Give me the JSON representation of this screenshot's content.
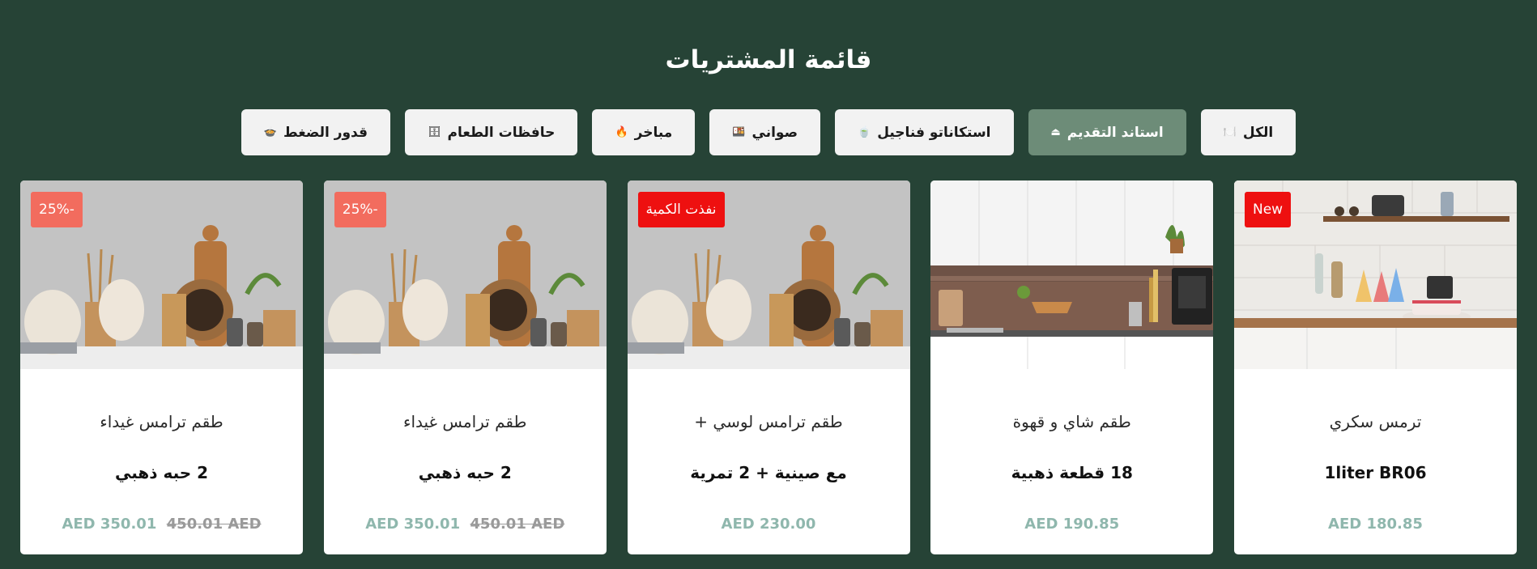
{
  "header": {
    "title": "قائمة المشتريات"
  },
  "filters": [
    {
      "label": "الكل",
      "icon": "🍽️",
      "active": false
    },
    {
      "label": "استاند التقديم",
      "icon": "⏏",
      "active": true
    },
    {
      "label": "استكاناتو فناجيل",
      "icon": "🍵",
      "active": false
    },
    {
      "label": "صواني",
      "icon": "🍱",
      "active": false
    },
    {
      "label": "مباخر",
      "icon": "🔥",
      "active": false
    },
    {
      "label": "حافظات الطعام",
      "icon": "🗄",
      "active": false
    },
    {
      "label": "قدور الضغط",
      "icon": "🍲",
      "active": false
    }
  ],
  "products": [
    {
      "name": "ترمس سكري",
      "subtitle": "1liter BR06",
      "price": "AED 180.85",
      "old_price": "",
      "badge": "New",
      "badge_type": "new",
      "image": "kitchen-shelf"
    },
    {
      "name": "طقم شاي و قهوة",
      "subtitle": "18 قطعة ذهبية",
      "price": "AED 190.85",
      "old_price": "",
      "badge": "",
      "badge_type": "",
      "image": "kitchen-counter"
    },
    {
      "name": "طقم ترامس لوسي +",
      "subtitle": "مع صينية + 2 تمرية",
      "price": "AED 230.00",
      "old_price": "",
      "badge": "نفذت الكمية",
      "badge_type": "soldout",
      "image": "wooden-utensils"
    },
    {
      "name": "طقم ترامس غيداء",
      "subtitle": "2 حبه ذهبي",
      "price": "AED 350.01",
      "old_price": "450.01 AED",
      "badge": "25%-",
      "badge_type": "discount",
      "image": "wooden-utensils"
    },
    {
      "name": "طقم ترامس غيداء",
      "subtitle": "2 حبه ذهبي",
      "price": "AED 350.01",
      "old_price": "450.01 AED",
      "badge": "25%-",
      "badge_type": "discount",
      "image": "wooden-utensils"
    }
  ]
}
